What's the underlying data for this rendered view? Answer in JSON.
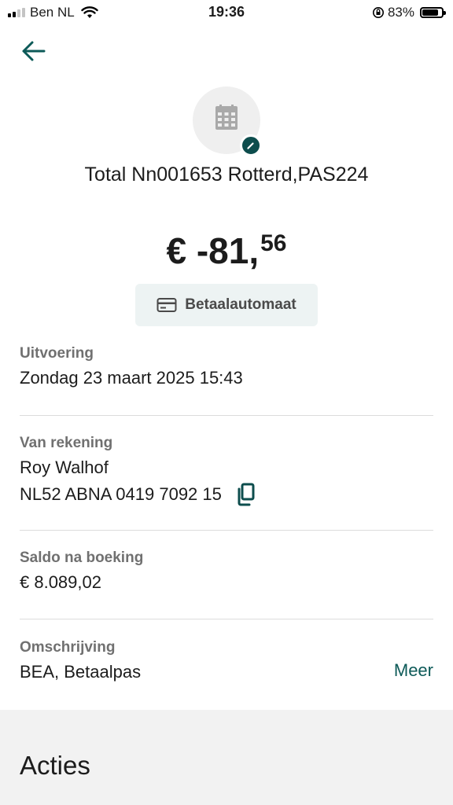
{
  "status_bar": {
    "carrier": "Ben NL",
    "time": "19:36",
    "battery_percent": "83%"
  },
  "transaction": {
    "merchant_name": "Total Nn001653 Rotterd,PAS224",
    "amount_main": "€ -81,",
    "amount_cents": "56",
    "type_label": "Betaalautomaat"
  },
  "details": {
    "execution": {
      "label": "Uitvoering",
      "value": "Zondag 23 maart 2025 15:43"
    },
    "from_account": {
      "label": "Van rekening",
      "holder": "Roy Walhof",
      "iban": "NL52 ABNA 0419 7092 15"
    },
    "balance_after": {
      "label": "Saldo na boeking",
      "value": "€ 8.089,02"
    },
    "description": {
      "label": "Omschrijving",
      "value": "BEA, Betaalpas",
      "more_label": "Meer"
    }
  },
  "actions": {
    "title": "Acties"
  },
  "colors": {
    "accent": "#0d5a58",
    "badge": "#0d4d4d",
    "chip_bg": "#edf3f3",
    "section_bg": "#f2f2f2"
  },
  "icons": {
    "back": "arrow-left-icon",
    "merchant": "calendar-icon",
    "edit": "pencil-icon",
    "payment_type": "credit-card-icon",
    "copy": "copy-icon"
  }
}
